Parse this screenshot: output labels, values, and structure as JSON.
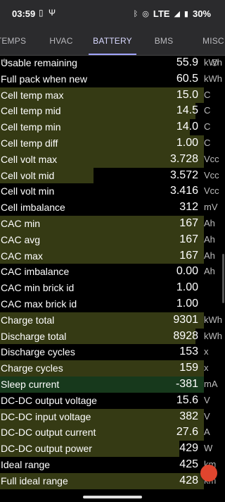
{
  "status_bar": {
    "time": "03:59",
    "network": "LTE",
    "battery_percent": "30%"
  },
  "tabs": [
    {
      "label": "TEMPS",
      "active": false
    },
    {
      "label": "HVAC",
      "active": false
    },
    {
      "label": "BATTERY",
      "active": true
    },
    {
      "label": "BMS",
      "active": false
    },
    {
      "label": "MISC",
      "active": false
    }
  ],
  "rows": [
    {
      "label": "Usable remaining",
      "value": "55.9",
      "unit": "kWh",
      "fill": 0.0
    },
    {
      "label": "Full pack when new",
      "value": "60.5",
      "unit": "kWh",
      "fill": 0.0
    },
    {
      "label": "Cell temp max",
      "value": "15.0",
      "unit": "C",
      "fill": 1.0
    },
    {
      "label": "Cell temp mid",
      "value": "14.5",
      "unit": "C",
      "fill": 0.96
    },
    {
      "label": "Cell temp min",
      "value": "14.0",
      "unit": "C",
      "fill": 0.93
    },
    {
      "label": "Cell temp diff",
      "value": "1.00",
      "unit": "C",
      "fill": 1.0
    },
    {
      "label": "Cell volt max",
      "value": "3.728",
      "unit": "Vcc",
      "fill": 1.0
    },
    {
      "label": "Cell volt mid",
      "value": "3.572",
      "unit": "Vcc",
      "fill": 0.46
    },
    {
      "label": "Cell volt min",
      "value": "3.416",
      "unit": "Vcc",
      "fill": 0.0
    },
    {
      "label": "Cell imbalance",
      "value": "312",
      "unit": "mV",
      "fill": 0.0
    },
    {
      "label": "CAC min",
      "value": "167",
      "unit": "Ah",
      "fill": 1.0
    },
    {
      "label": "CAC avg",
      "value": "167",
      "unit": "Ah",
      "fill": 1.0
    },
    {
      "label": "CAC max",
      "value": "167",
      "unit": "Ah",
      "fill": 1.0
    },
    {
      "label": "CAC imbalance",
      "value": "0.00",
      "unit": "Ah",
      "fill": 0.0
    },
    {
      "label": "CAC min brick id",
      "value": "1.00",
      "unit": "",
      "fill": 0.0
    },
    {
      "label": "CAC max brick id",
      "value": "1.00",
      "unit": "",
      "fill": 0.0
    },
    {
      "label": "Charge total",
      "value": "9301",
      "unit": "kWh",
      "fill": 1.0
    },
    {
      "label": "Discharge total",
      "value": "8928",
      "unit": "kWh",
      "fill": 0.96
    },
    {
      "label": "Discharge cycles",
      "value": "153",
      "unit": "x",
      "fill": 0.0
    },
    {
      "label": "Charge cycles",
      "value": "159",
      "unit": "x",
      "fill": 1.0
    },
    {
      "label": "Sleep current",
      "value": "-381",
      "unit": "mA",
      "fill": 1.0,
      "green": true
    },
    {
      "label": "DC-DC output voltage",
      "value": "15.6",
      "unit": "V",
      "fill": 0.0
    },
    {
      "label": "DC-DC input voltage",
      "value": "382",
      "unit": "V",
      "fill": 1.0
    },
    {
      "label": "DC-DC output current",
      "value": "27.6",
      "unit": "A",
      "fill": 1.0
    },
    {
      "label": "DC-DC output power",
      "value": "429",
      "unit": "W",
      "fill": 0.88
    },
    {
      "label": "Ideal range",
      "value": "425",
      "unit": "km",
      "fill": 0.0
    },
    {
      "label": "Full ideal range",
      "value": "428",
      "unit": "km",
      "fill": 1.0
    }
  ]
}
